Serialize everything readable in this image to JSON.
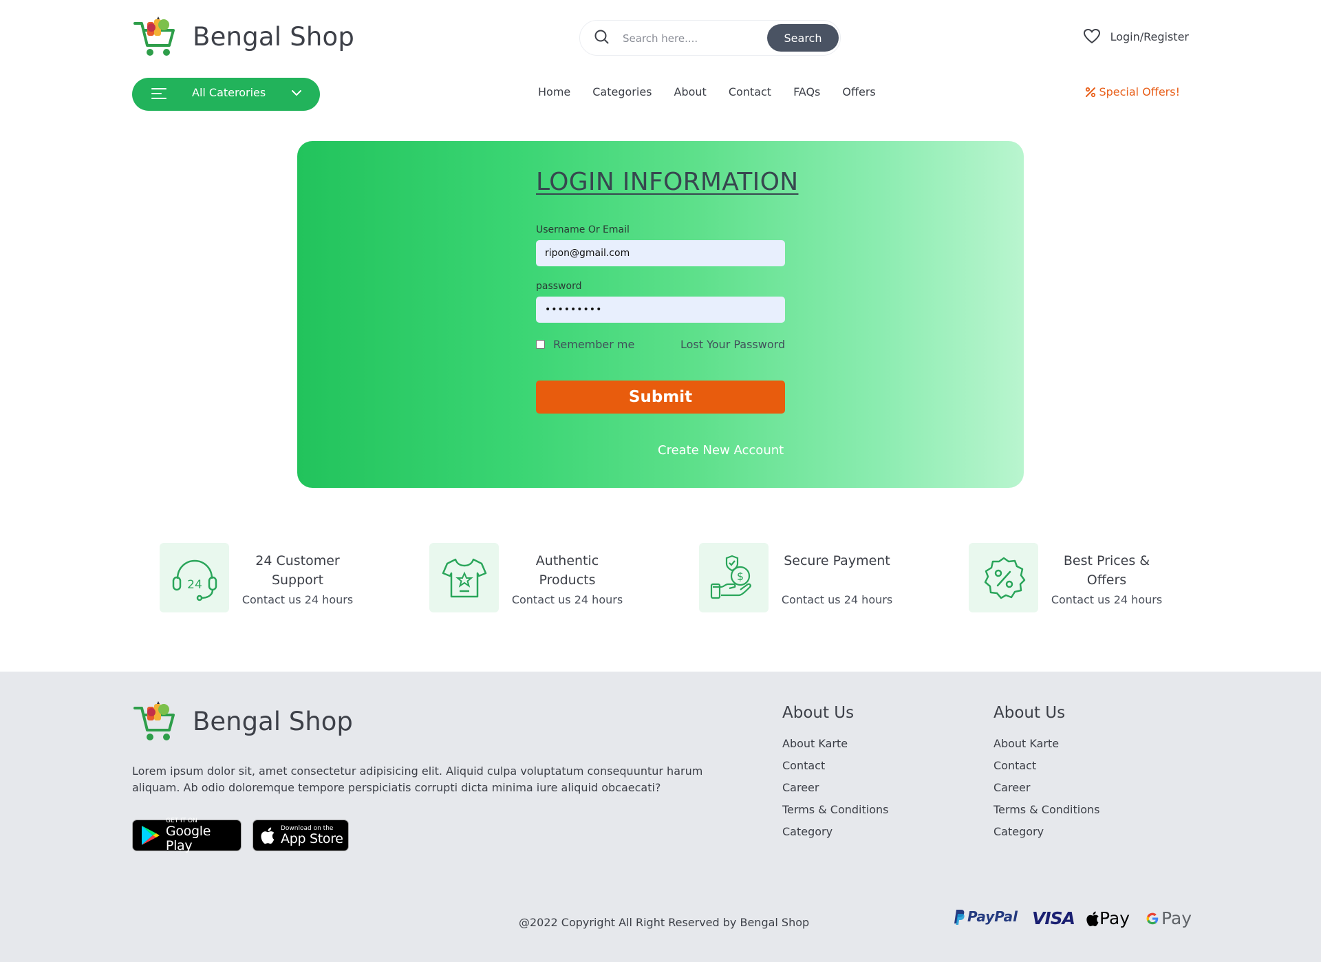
{
  "header": {
    "brand": "Bengal Shop",
    "search_placeholder": "Search here....",
    "search_button": "Search",
    "login_label": "Login/Register",
    "categories_button": "All Caterories",
    "nav": [
      "Home",
      "Categories",
      "About",
      "Contact",
      "FAQs",
      "Offers"
    ],
    "special_offers": "Special Offers!"
  },
  "login": {
    "title": "LOGIN INFORMATION",
    "username_label": "Username Or Email",
    "username_value": "ripon@gmail.com",
    "password_label": "password",
    "password_value": "•••••••••",
    "remember_label": "Remember me",
    "lost_password": "Lost Your Password",
    "submit": "Submit",
    "create_account": "Create New Account"
  },
  "features": [
    {
      "title": "24 Customer Support",
      "subtitle": "Contact us 24 hours",
      "icon": "headset-24-icon"
    },
    {
      "title": "Authentic Products",
      "subtitle": "Contact us 24 hours",
      "icon": "tshirt-star-icon"
    },
    {
      "title": "Secure Payment",
      "subtitle": "Contact us 24 hours",
      "icon": "hand-money-shield-icon"
    },
    {
      "title": "Best Prices & Offers",
      "subtitle": "Contact us 24 hours",
      "icon": "percent-badge-icon"
    }
  ],
  "footer": {
    "brand": "Bengal Shop",
    "description": "Lorem ipsum dolor sit, amet consectetur adipisicing elit. Aliquid culpa voluptatum consequuntur harum aliquam. Ab odio doloremque tempore perspiciatis corrupti dicta minima iure aliquid obcaecati?",
    "google_play": {
      "small": "GET IT ON",
      "big": "Google Play"
    },
    "app_store": {
      "small": "Download on the",
      "big": "App Store"
    },
    "columns": [
      {
        "title": "About Us",
        "links": [
          "About Karte",
          "Contact",
          "Career",
          "Terms & Conditions",
          "Category"
        ]
      },
      {
        "title": "About Us",
        "links": [
          "About Karte",
          "Contact",
          "Career",
          "Terms & Conditions",
          "Category"
        ]
      }
    ],
    "copyright": "@2022 Copyright All Right Reserved by Bengal Shop",
    "payments": {
      "paypal": "PayPal",
      "visa": "VISA",
      "apple_pay": "Pay",
      "google_pay": "Pay"
    }
  },
  "colors": {
    "green": "#22b35b",
    "orange": "#e85c0d",
    "dark_button": "#4a5363",
    "footer_bg": "#e6e8ec"
  }
}
